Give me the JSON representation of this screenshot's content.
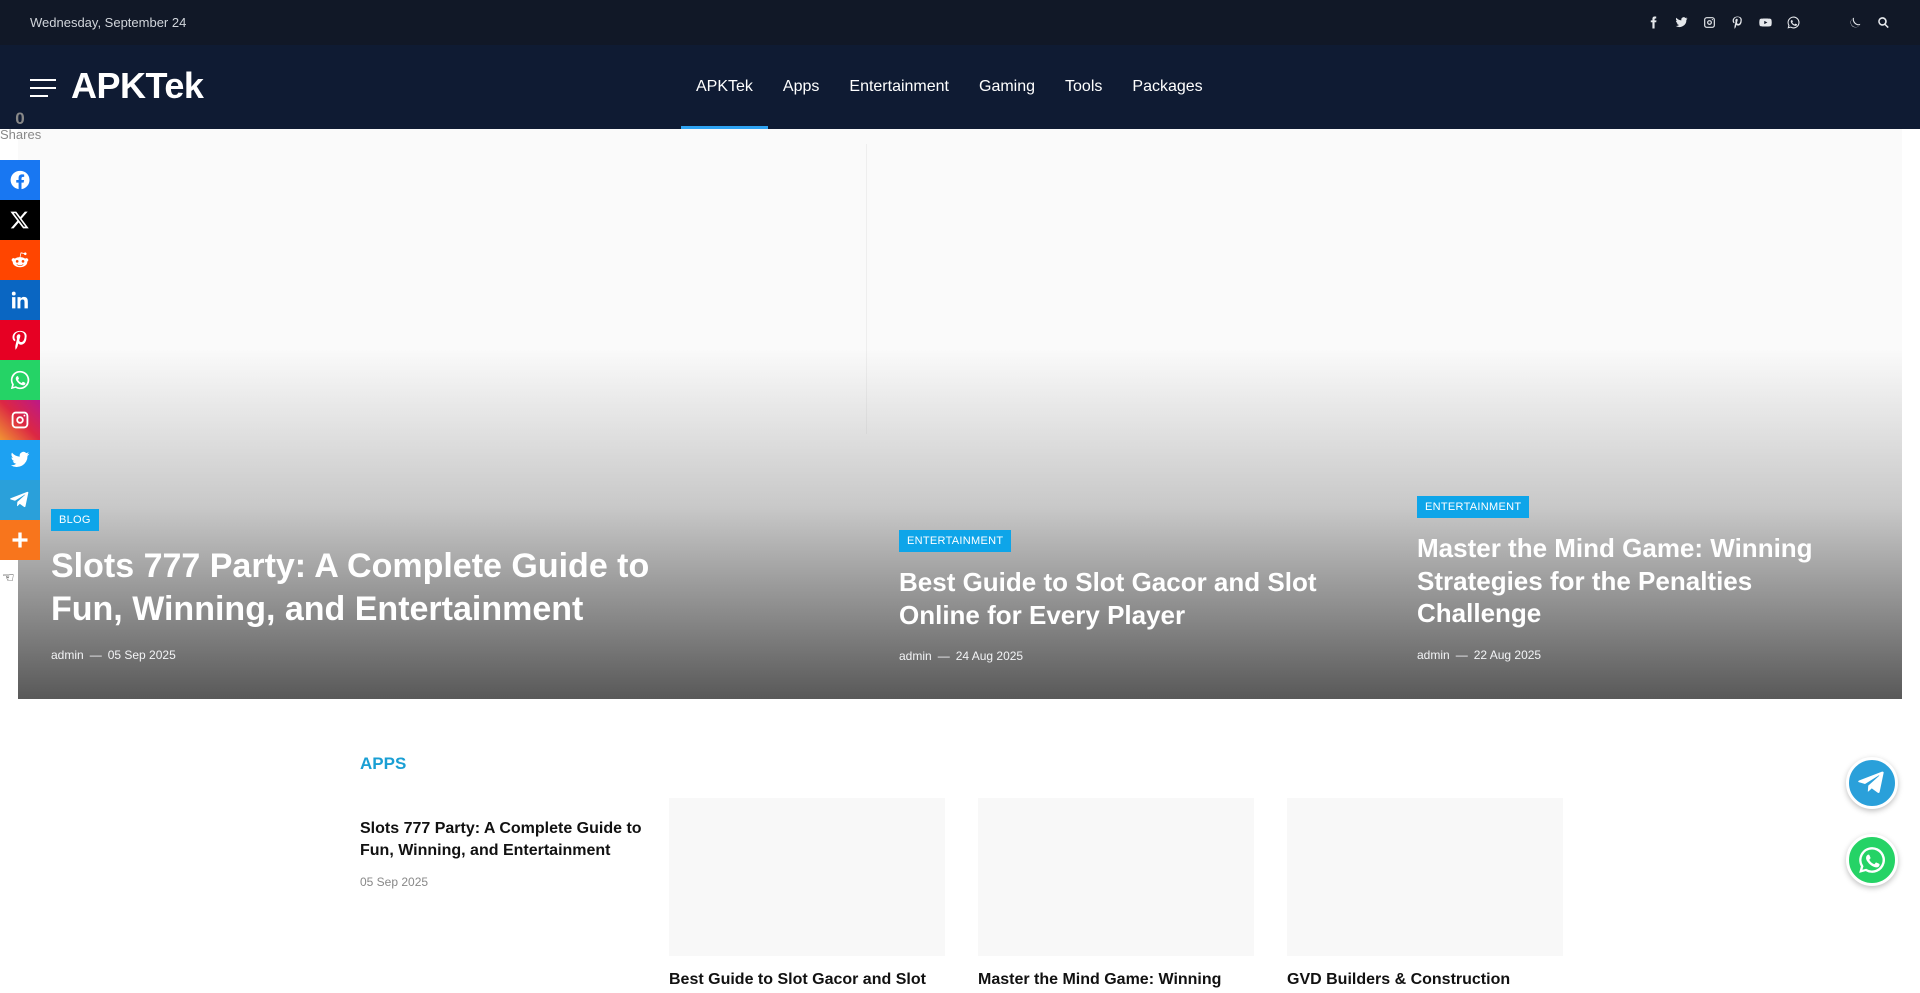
{
  "topbar": {
    "date": "Wednesday, September 24",
    "social_icons": [
      "facebook-icon",
      "twitter-icon",
      "instagram-icon",
      "pinterest-icon",
      "youtube-icon",
      "whatsapp-icon"
    ],
    "theme_icon": "moon-icon",
    "search_icon": "search-icon"
  },
  "header": {
    "logo": "APKTek",
    "nav": [
      {
        "label": "APKTek",
        "active": true
      },
      {
        "label": "Apps"
      },
      {
        "label": "Entertainment"
      },
      {
        "label": "Gaming"
      },
      {
        "label": "Tools"
      },
      {
        "label": "Packages"
      }
    ]
  },
  "share": {
    "count": "0",
    "label": "Shares",
    "buttons": [
      {
        "name": "facebook",
        "color": "#1877f2"
      },
      {
        "name": "x",
        "color": "#000000"
      },
      {
        "name": "reddit",
        "color": "#ff4500"
      },
      {
        "name": "linkedin",
        "color": "#0a66c2"
      },
      {
        "name": "pinterest",
        "color": "#e60023"
      },
      {
        "name": "whatsapp",
        "color": "#25d366"
      },
      {
        "name": "instagram",
        "color": "#d6249f"
      },
      {
        "name": "twitter",
        "color": "#1da1f2"
      },
      {
        "name": "telegram",
        "color": "#2aa0da"
      },
      {
        "name": "more",
        "color": "#f8751c"
      }
    ]
  },
  "hero": {
    "main": {
      "category": "BLOG",
      "title": "Slots 777 Party: A Complete Guide to Fun, Winning, and Entertainment",
      "author": "admin",
      "date": "05 Sep 2025"
    },
    "second": {
      "category": "ENTERTAINMENT",
      "title": "Best Guide to Slot Gacor and Slot Online for Every Player",
      "author": "admin",
      "date": "24 Aug 2025"
    },
    "third": {
      "category": "ENTERTAINMENT",
      "title": "Master the Mind Game: Winning Strategies for the Penalties Challenge",
      "author": "admin",
      "date": "22 Aug 2025"
    },
    "separator": "—"
  },
  "apps": {
    "title": "APPS",
    "lead": {
      "title": "Slots 777 Party: A Complete Guide to Fun, Winning, and Entertainment",
      "date": "05 Sep 2025"
    },
    "cards": [
      {
        "title": "Best Guide to Slot Gacor and Slot"
      },
      {
        "title": "Master the Mind Game: Winning"
      },
      {
        "title": "GVD Builders & Construction"
      }
    ]
  },
  "floating": {
    "telegram_color": "#2aa0da",
    "whatsapp_color": "#25d366"
  }
}
